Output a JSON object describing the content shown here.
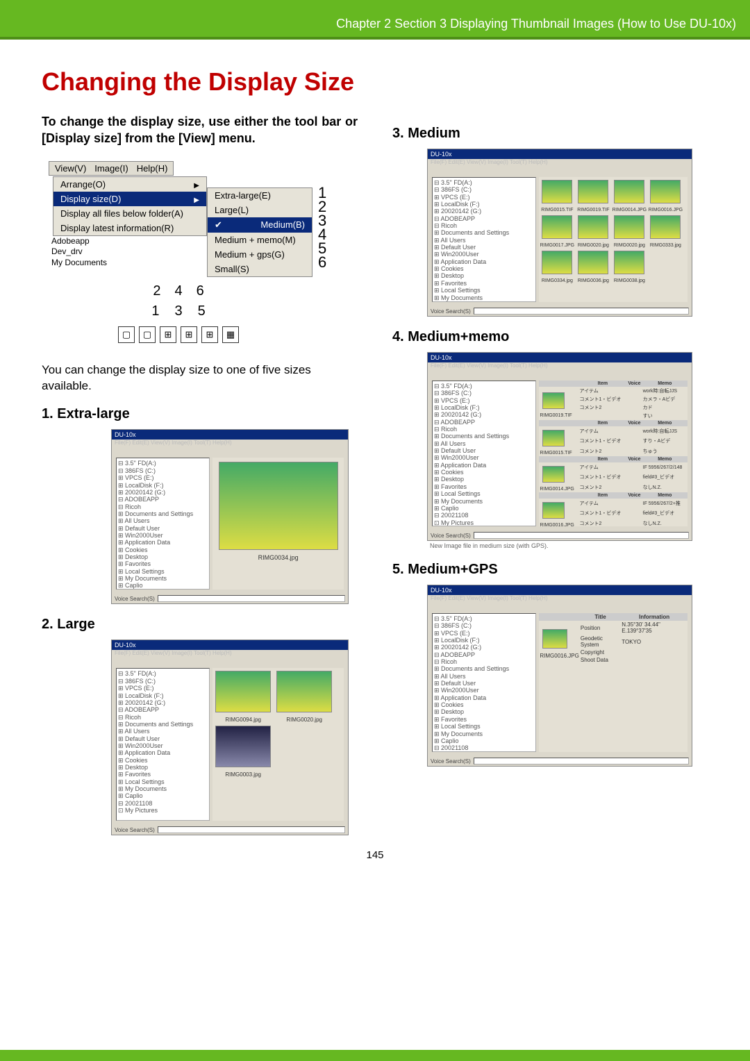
{
  "header": "Chapter 2 Section 3 Displaying Thumbnail Images (How to Use DU-10x)",
  "title": "Changing the Display Size",
  "intro": "To change the display size, use either the tool bar or [Display size] from the [View] menu.",
  "body1": "You can change the display size to one of five sizes available.",
  "left": {
    "s1": "1.  Extra-large",
    "s2": "2.  Large"
  },
  "right": {
    "s3": "3.  Medium",
    "s4": "4.  Medium+memo",
    "s5": "5.  Medium+GPS"
  },
  "menu": {
    "bar": {
      "view": "View(V)",
      "image": "Image(I)",
      "help": "Help(H)"
    },
    "items": {
      "arrange": "Arrange(O)",
      "display_size": "Display size(D)",
      "display_all": "Display all files below folder(A)",
      "display_latest": "Display latest information(R)"
    },
    "sub": {
      "extra": "Extra-large(E)",
      "large": "Large(L)",
      "medium": "Medium(B)",
      "memo": "Medium + memo(M)",
      "gps": "Medium + gps(G)",
      "small": "Small(S)"
    },
    "nums_right": [
      "1",
      "2",
      "3",
      "4",
      "5",
      "6"
    ],
    "nums_icons_top": [
      "2",
      "4",
      "6"
    ],
    "nums_icons_bot": [
      "1",
      "3",
      "5"
    ],
    "tree_tail": [
      "Adobeapp",
      "Dev_drv",
      "My Documents"
    ]
  },
  "shot": {
    "title": "DU-10x",
    "menu_line": "File(F)  Edit(E)  View(V)  Image(I)  Tool(T)  Help(H)",
    "voice_search": "Voice Search(S)",
    "tree": [
      "⊟ 3.5\" FD(A:)",
      "⊟ 386FS (C:)",
      "⊞ VPCS (E:)",
      "⊞ LocalDisk (F:)",
      "⊞ 20020142 (G:)",
      "  ⊟ ADOBEAPP",
      "  ⊟ Ricoh",
      "  ⊞ Documents and Settings",
      "    ⊞ All Users",
      "    ⊞ Default User",
      "    ⊞ Win2000User",
      "      ⊞ Application Data",
      "      ⊞ Cookies",
      "      ⊞ Desktop",
      "      ⊞ Favorites",
      "      ⊞ Local Settings",
      "      ⊞ My Documents",
      "        ⊞ Caplio",
      "          ⊟ 20021108",
      "          ⊡ My Pictures"
    ],
    "thumbs": {
      "a": "RIMG0015.TIF",
      "b": "RIMG0019.TIF",
      "c": "RIMG0014.JPG",
      "d": "RIMG0016.JPG",
      "e": "RIMG0017.JPG",
      "f": "RIMG0020.jpg",
      "g": "RIMG0020.jpg",
      "h": "RIMG0333.jpg",
      "i": "RIMG0334.jpg",
      "j": "RIMG0036.jpg",
      "k": "RIMG0038.jpg",
      "single": "RIMG0034.jpg",
      "large1": "RIMG0094.jpg",
      "large2": "RIMG0020.jpg",
      "large3": "RIMG0003.jpg"
    },
    "memo": {
      "col_item": "Item",
      "col_voice": "Voice",
      "col_memo": "Memo",
      "r1a": "アイテム",
      "r1b": "work時:自転JJS",
      "r2a": "コメント1・ビデオ",
      "r2b": "カメラ・Aビデ",
      "r3a": "コメント2",
      "r3b": "カド",
      "r4b": "すい",
      "r5a": "アイテム",
      "r5b": "work時:自転JJS",
      "r6a": "コメント1・ビデオ",
      "r6b": "すり・Aビデ",
      "r7a": "コメント2",
      "r7b": "ちゅう",
      "r8a": "アイテム",
      "r8b": "IF 5956/267/2/148",
      "r9a": "コメント1・ビデオ",
      "r9b": "field#3_ビデオ",
      "r10a": "コメント2",
      "r10b": "なしN.Z.",
      "r11a": "アイテム",
      "r11b": "IF 5956/267/2+推",
      "r12a": "コメント1・ビデオ",
      "r12b": "field#3_ビデオ",
      "r13a": "コメント2",
      "r13b": "なしN.Z.",
      "foot": "New Image file in medium size (with GPS)."
    },
    "gps": {
      "col_title": "Title",
      "col_info": "Information",
      "r1a": "Position",
      "r1b": "N.35°30' 34.44\" E.139°37'35",
      "r2a": "Geodetic System",
      "r2b": "TOKYO",
      "r3a": "Copyright",
      "r4a": "Shoot Data"
    }
  },
  "page": "145"
}
